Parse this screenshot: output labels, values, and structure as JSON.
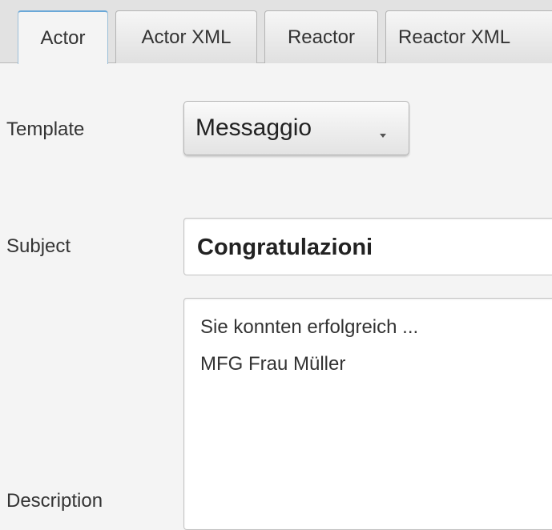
{
  "tabs": [
    {
      "label": "Actor",
      "selected": true
    },
    {
      "label": "Actor XML",
      "selected": false
    },
    {
      "label": "Reactor",
      "selected": false
    },
    {
      "label": "Reactor XML",
      "selected": false
    }
  ],
  "form": {
    "template": {
      "label": "Template",
      "value": "Messaggio"
    },
    "subject": {
      "label": "Subject",
      "value": "Congratulazioni"
    },
    "description": {
      "label": "Description",
      "lines": [
        "Sie konnten erfolgreich ...",
        "MFG Frau Müller"
      ]
    }
  },
  "icons": {
    "combo_arrow": "chevron-down-icon"
  },
  "colors": {
    "selected_tab_accent": "#6aa8d8",
    "background": "#f4f4f4"
  }
}
